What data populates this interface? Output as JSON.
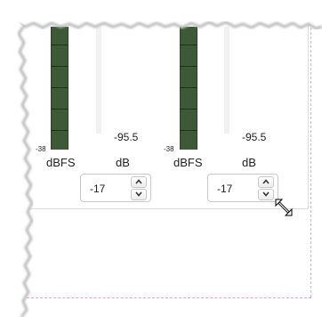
{
  "meters": [
    {
      "min_label": "-38",
      "value": "-95.5",
      "unit_left": "dBFS",
      "unit_right": "dB",
      "spinner_value": "-17"
    },
    {
      "min_label": "-38",
      "value": "-95.5",
      "unit_left": "dBFS",
      "unit_right": "dB",
      "spinner_value": "-17"
    }
  ],
  "icons": {
    "resize": "resize-diagonal-icon",
    "spin_up": "chevron-up-icon",
    "spin_down": "chevron-down-icon"
  },
  "colors": {
    "meter_fill": "#3d5a36",
    "page_edge": "#e7a9c6"
  }
}
